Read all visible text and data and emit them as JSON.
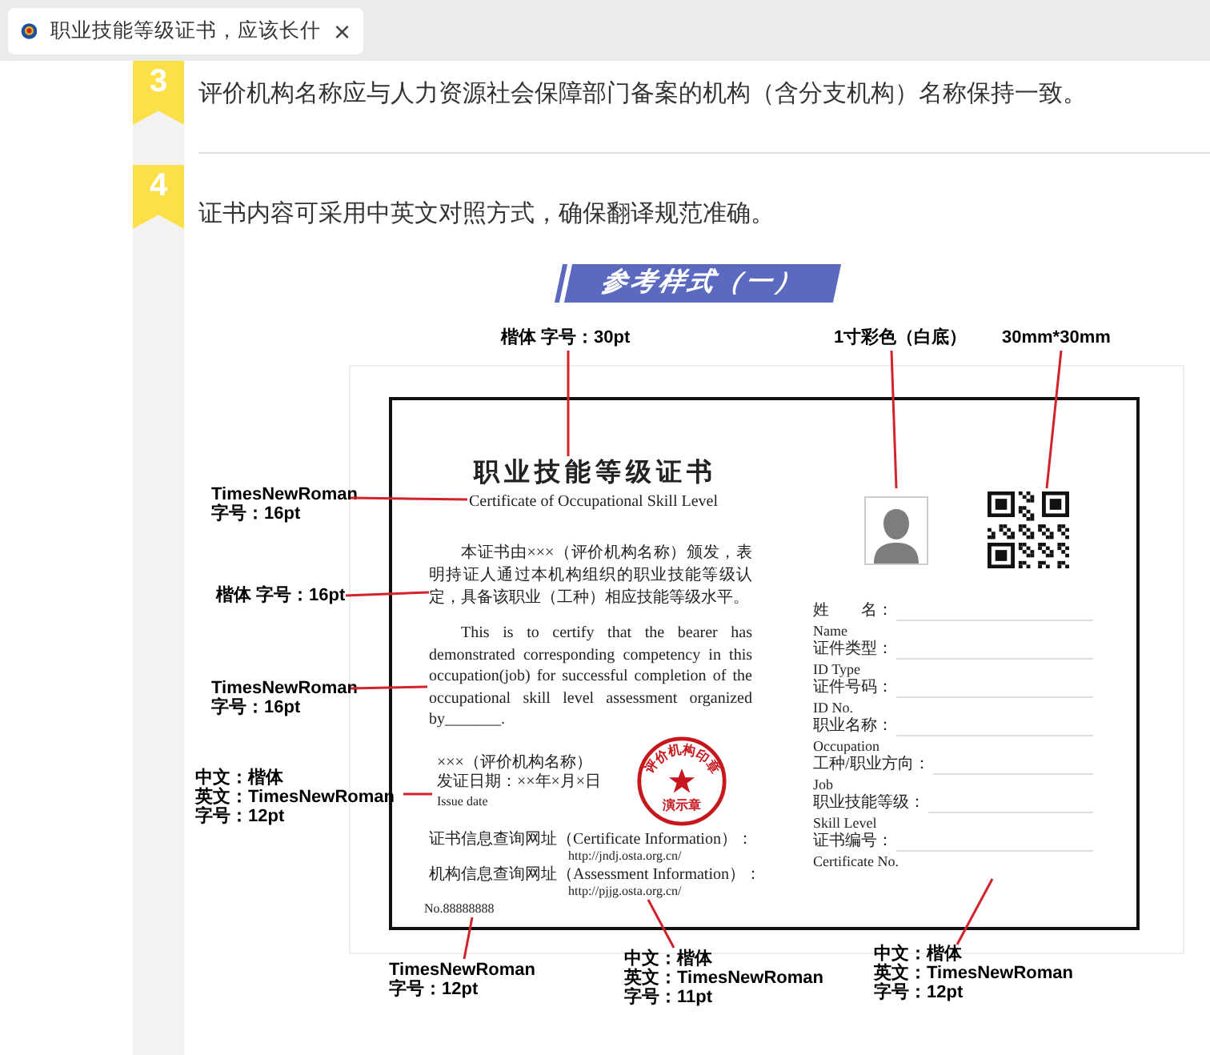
{
  "tab": {
    "title": "职业技能等级证书，应该长什",
    "close": "×"
  },
  "steps": [
    {
      "number": "3",
      "text": "评价机构名称应与人力资源社会保障部门备案的机构（含分支机构）名称保持一致。"
    },
    {
      "number": "4",
      "text": "证书内容可采用中英文对照方式，确保翻译规范准确。"
    }
  ],
  "figure": {
    "banner": "参考样式（一）",
    "certificate": {
      "title_cn": "职业技能等级证书",
      "title_en": "Certificate of Occupational Skill Level",
      "body_cn": "本证书由×××（评价机构名称）颁发，表明持证人通过本机构组织的职业技能等级认定，具备该职业（工种）相应技能等级水平。",
      "body_en": "This is to certify that the bearer has demonstrated corresponding competency in this occupation(job) for successful completion of the occupational skill level assessment organized by_______.",
      "issuer_lines": [
        "×××（评价机构名称）",
        "发证日期：××年×月×日",
        "Issue date"
      ],
      "seal": {
        "top": "评价机构印章",
        "bottom": "演示章"
      },
      "query_lines": [
        {
          "label": "证书信息查询网址（Certificate Information）：",
          "url": "http://jndj.osta.org.cn/"
        },
        {
          "label": "机构信息查询网址（Assessment Information）：",
          "url": "http://pjjg.osta.org.cn/"
        }
      ],
      "number": "No.88888888",
      "fields": [
        {
          "cn": "姓　　名：",
          "en": "Name"
        },
        {
          "cn": "证件类型：",
          "en": "ID Type"
        },
        {
          "cn": "证件号码：",
          "en": "ID No."
        },
        {
          "cn": "职业名称：",
          "en": "Occupation"
        },
        {
          "cn": "工种/职业方向：",
          "en": "Job"
        },
        {
          "cn": "职业技能等级：",
          "en": "Skill Level"
        },
        {
          "cn": "证书编号：",
          "en": "Certificate No."
        }
      ]
    },
    "annotations": [
      {
        "lines": [
          "楷体 字号：30pt"
        ]
      },
      {
        "lines": [
          "1寸彩色（白底）"
        ]
      },
      {
        "lines": [
          "30mm*30mm"
        ]
      },
      {
        "lines": [
          "TimesNewRoman",
          "字号：16pt"
        ]
      },
      {
        "lines": [
          "楷体 字号：16pt"
        ]
      },
      {
        "lines": [
          "TimesNewRoman",
          "字号：16pt"
        ]
      },
      {
        "lines": [
          "中文：楷体",
          "英文：TimesNewRoman",
          "字号：12pt"
        ]
      },
      {
        "lines": [
          "TimesNewRoman",
          "字号：12pt"
        ]
      },
      {
        "lines": [
          "中文：楷体",
          "英文：TimesNewRoman",
          "字号：11pt"
        ]
      },
      {
        "lines": [
          "中文：楷体",
          "英文：TimesNewRoman",
          "字号：12pt"
        ]
      }
    ]
  }
}
